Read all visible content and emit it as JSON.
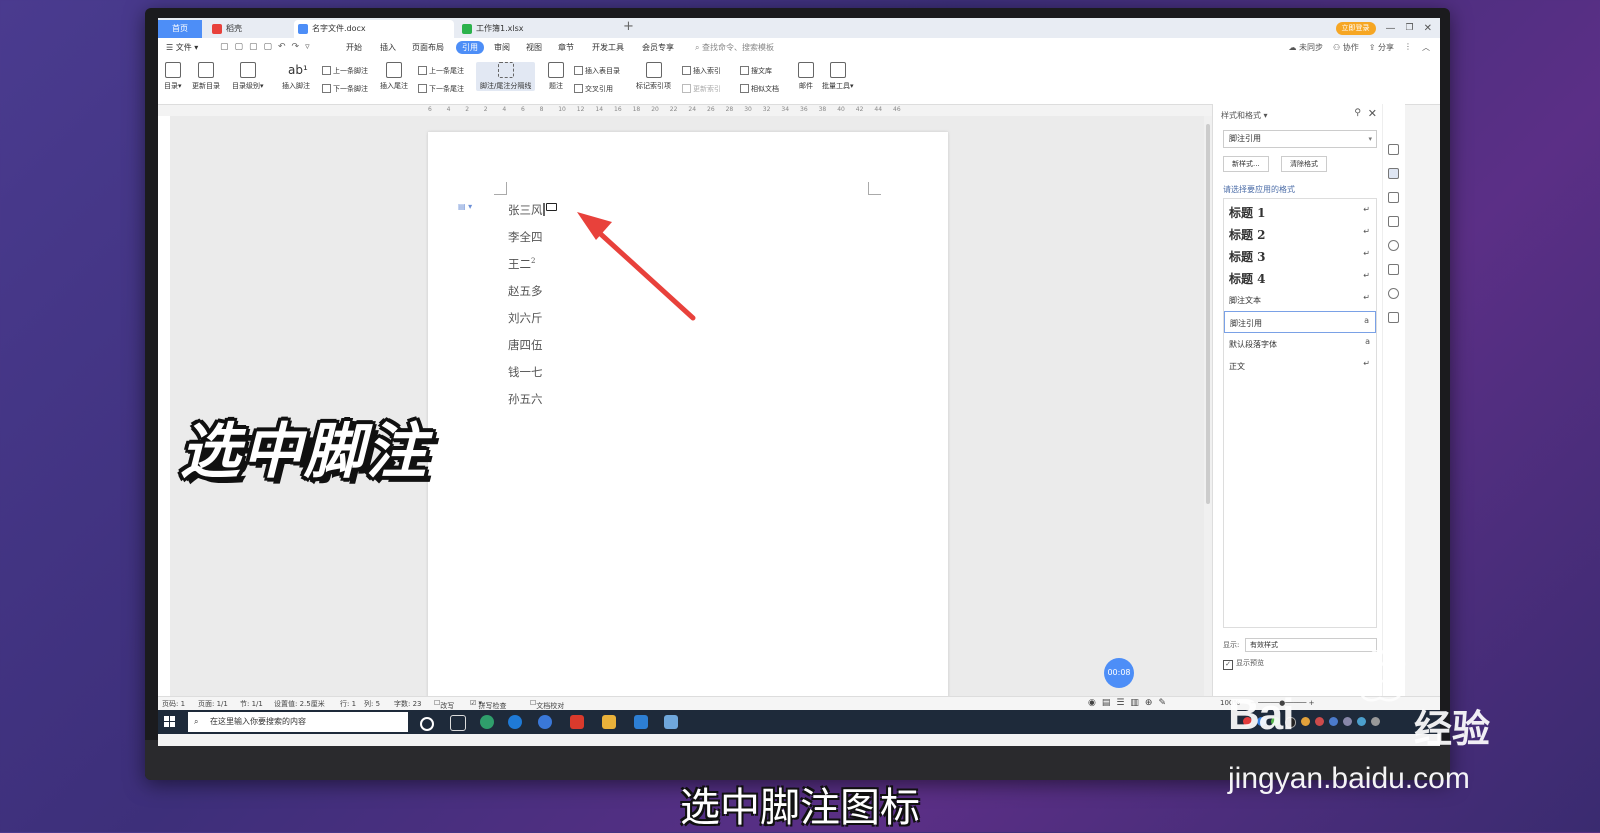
{
  "tabs": {
    "home": "首页",
    "t1": "稻壳",
    "t2": "名字文件.docx",
    "t3": "工作簿1.xlsx",
    "login": "立即登录"
  },
  "menu": {
    "file": "文件",
    "items": [
      "开始",
      "插入",
      "页面布局",
      "引用",
      "审阅",
      "视图",
      "章节",
      "开发工具",
      "会员专享"
    ],
    "search": "查找命令、搜索模板",
    "sync": "未同步",
    "collab": "协作",
    "share": "分享"
  },
  "ribbon": {
    "toc": "目录",
    "update_toc": "更新目录",
    "toc_level": "目录级别",
    "insert_footnote": "插入脚注",
    "prev_footnote": "上一条脚注",
    "next_footnote": "下一条脚注",
    "insert_endnote": "插入尾注",
    "prev_endnote": "上一条尾注",
    "next_endnote": "下一条尾注",
    "separator": "脚注/尾注分隔线",
    "caption": "题注",
    "insert_table_toc": "插入表目录",
    "cross_ref": "交叉引用",
    "mark_index": "标记索引项",
    "insert_index": "插入索引",
    "update_index": "更新索引",
    "search_lib": "搜文库",
    "similar_doc": "相似文档",
    "mail": "邮件",
    "batch_tools": "批量工具"
  },
  "ruler": [
    "6",
    "4",
    "2",
    "2",
    "4",
    "6",
    "8",
    "10",
    "12",
    "14",
    "16",
    "18",
    "20",
    "22",
    "24",
    "26",
    "28",
    "30",
    "32",
    "34",
    "36",
    "38",
    "40",
    "42",
    "44",
    "46"
  ],
  "document": {
    "lines": [
      "张三风",
      "李全四",
      "王二",
      "赵五多",
      "刘六斤",
      "唐四伍",
      "钱一七",
      "孙五六"
    ],
    "footnote_mark": "2"
  },
  "timer": "00:08",
  "panel": {
    "title": "样式和格式",
    "current": "脚注引用",
    "new_style": "新样式...",
    "clear_format": "清除格式",
    "choose_label": "请选择要应用的格式",
    "styles": [
      {
        "name": "标题  1",
        "mark": "↵"
      },
      {
        "name": "标题  2",
        "mark": "↵"
      },
      {
        "name": "标题  3",
        "mark": "↵"
      },
      {
        "name": "标题  4",
        "mark": "↵"
      },
      {
        "name": "脚注文本",
        "mark": "↵"
      },
      {
        "name": "脚注引用",
        "mark": "a"
      },
      {
        "name": "默认段落字体",
        "mark": "a"
      },
      {
        "name": "正文",
        "mark": "↵"
      }
    ],
    "show_label": "显示:",
    "show_value": "有效样式",
    "preview_label": "显示预览"
  },
  "status": {
    "page": "页码: 1",
    "pages": "页面: 1/1",
    "section": "节: 1/1",
    "pos": "设置值: 2.5厘米",
    "row": "行: 1",
    "col": "列: 5",
    "words": "字数: 23",
    "overwrite": "改写",
    "spell": "拼写检查",
    "proof": "文档校对",
    "zoom": "100%"
  },
  "taskbar": {
    "search_placeholder": "在这里输入你要搜索的内容"
  },
  "overlay": {
    "big": "选中脚注",
    "subtitle": "选中脚注图标"
  },
  "watermark": {
    "brand": "Bai",
    "brand2": "经验",
    "url": "jingyan.baidu.com"
  },
  "colors": {
    "accent": "#4d8ef7",
    "arrow": "#e8413b"
  }
}
